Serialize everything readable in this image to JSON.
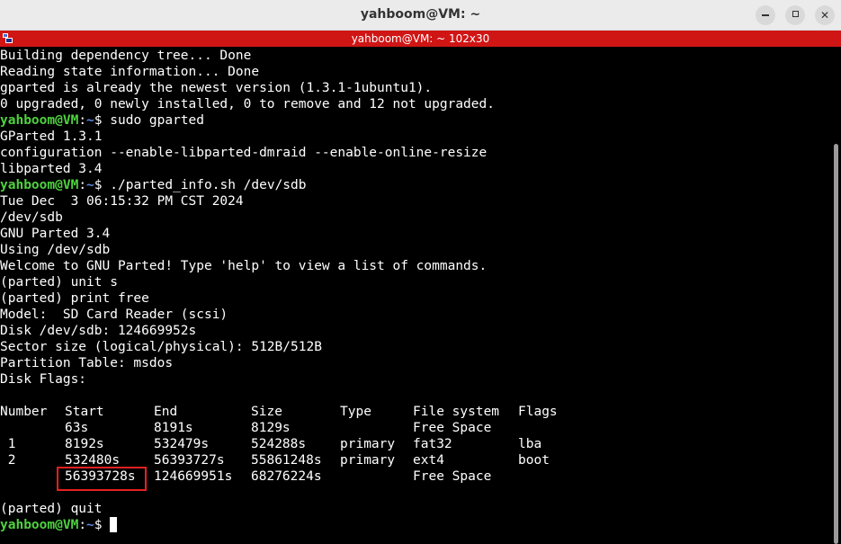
{
  "window": {
    "title": "yahboom@VM: ~",
    "tab_title": "yahboom@VM: ~ 102x30"
  },
  "colors": {
    "prompt_user": "#4fd23f",
    "prompt_path": "#5c87e0",
    "tab_bar": "#d01515",
    "highlight": "#e82020"
  },
  "prompt": {
    "user": "yahboom@VM",
    "sep": ":",
    "path": "~",
    "symbol": "$ "
  },
  "lines": [
    {
      "type": "text",
      "text": "Building dependency tree... Done"
    },
    {
      "type": "text",
      "text": "Reading state information... Done"
    },
    {
      "type": "text",
      "text": "gparted is already the newest version (1.3.1-1ubuntu1)."
    },
    {
      "type": "text",
      "text": "0 upgraded, 0 newly installed, 0 to remove and 12 not upgraded."
    },
    {
      "type": "prompt",
      "command": "sudo gparted"
    },
    {
      "type": "text",
      "text": "GParted 1.3.1"
    },
    {
      "type": "text",
      "text": "configuration --enable-libparted-dmraid --enable-online-resize"
    },
    {
      "type": "text",
      "text": "libparted 3.4"
    },
    {
      "type": "prompt",
      "command": "./parted_info.sh /dev/sdb"
    },
    {
      "type": "text",
      "text": "Tue Dec  3 06:15:32 PM CST 2024"
    },
    {
      "type": "text",
      "text": "/dev/sdb"
    },
    {
      "type": "text",
      "text": "GNU Parted 3.4"
    },
    {
      "type": "text",
      "text": "Using /dev/sdb"
    },
    {
      "type": "text",
      "text": "Welcome to GNU Parted! Type 'help' to view a list of commands."
    },
    {
      "type": "text",
      "text": "(parted) unit s"
    },
    {
      "type": "text",
      "text": "(parted) print free"
    },
    {
      "type": "text",
      "text": "Model:  SD Card Reader (scsi)"
    },
    {
      "type": "text",
      "text": "Disk /dev/sdb: 124669952s"
    },
    {
      "type": "text",
      "text": "Sector size (logical/physical): 512B/512B"
    },
    {
      "type": "text",
      "text": "Partition Table: msdos"
    },
    {
      "type": "text",
      "text": "Disk Flags:"
    },
    {
      "type": "text",
      "text": ""
    }
  ],
  "partition_table": {
    "headers": [
      "Number",
      "Start",
      "End",
      "Size",
      "Type",
      "File system",
      "Flags"
    ],
    "rows": [
      [
        "",
        "63s",
        "8191s",
        "8129s",
        "",
        "Free Space",
        ""
      ],
      [
        " 1",
        "8192s",
        "532479s",
        "524288s",
        "primary",
        "fat32",
        "lba"
      ],
      [
        " 2",
        "532480s",
        "56393727s",
        "55861248s",
        "primary",
        "ext4",
        "boot"
      ],
      [
        "",
        "56393728s",
        "124669951s",
        "68276224s",
        "",
        "Free Space",
        ""
      ]
    ]
  },
  "trailing_lines": [
    {
      "type": "text",
      "text": ""
    },
    {
      "type": "text",
      "text": "(parted) quit"
    },
    {
      "type": "prompt",
      "command": ""
    }
  ]
}
